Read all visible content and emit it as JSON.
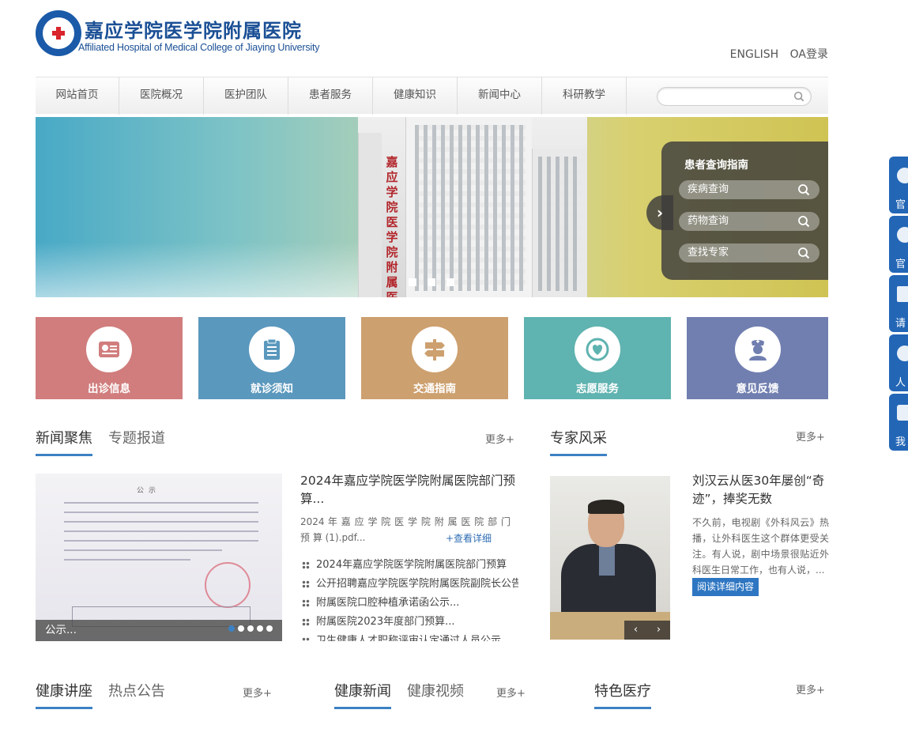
{
  "header": {
    "title_cn": "嘉应学院医学院附属医院",
    "title_en": "Affiliated Hospital of Medical College of Jiaying University",
    "links": [
      "ENGLISH",
      "OA登录"
    ]
  },
  "nav": {
    "items": [
      "网站首页",
      "医院概况",
      "医护团队",
      "患者服务",
      "健康知识",
      "新闻中心",
      "科研教学"
    ],
    "search_placeholder": ""
  },
  "banner": {
    "sign_text": "嘉应学院医学院附属医院",
    "guide": {
      "title": "患者查询指南",
      "buttons": [
        "疾病查询",
        "药物查询",
        "查找专家"
      ]
    },
    "slide_count": 3
  },
  "tiles": [
    {
      "label": "出诊信息",
      "color": "#d17d7d",
      "icon": "schedule-icon"
    },
    {
      "label": "就诊须知",
      "color": "#5b98bd",
      "icon": "clipboard-icon"
    },
    {
      "label": "交通指南",
      "color": "#cda06f",
      "icon": "signpost-icon"
    },
    {
      "label": "志愿服务",
      "color": "#5fb3b0",
      "icon": "volunteer-icon"
    },
    {
      "label": "意见反馈",
      "color": "#717fb0",
      "icon": "nurse-icon"
    }
  ],
  "news": {
    "tabs": [
      "新闻聚焦",
      "专题报道"
    ],
    "more": "更多+",
    "photo_doc_title": "公示",
    "photo_caption": "公示...",
    "headline": "2024年嘉应学院医学院附属医院部门预算...",
    "summary": "2024 年 嘉 应 学 院 医 学 院 附 属 医 院 部 门 预 算 (1).pdf...",
    "detail_link": "+查看详细",
    "list": [
      "2024年嘉应学院医学院附属医院部门预算",
      "公开招聘嘉应学院医学院附属医院副院长公告",
      "附属医院口腔种植承诺函公示...",
      "附属医院2023年度部门预算...",
      "卫生健康人才职称评审认定通过人员公示"
    ]
  },
  "expert": {
    "tab": "专家风采",
    "more": "更多+",
    "title": "刘汉云从医30年屡创“奇迹”，捧奖无数",
    "text": "不久前，电视剧《外科风云》热播，让外科医生这个群体更受关注。有人说，剧中场景很贴近外科医生日常工作，也有人说，...",
    "read_button": "阅读详细内容",
    "prev": "‹",
    "next": "›"
  },
  "bottom": {
    "group1": {
      "tabs": [
        "健康讲座",
        "热点公告"
      ],
      "more": "更多+"
    },
    "group2": {
      "tabs": [
        "健康新闻",
        "健康视频"
      ],
      "more": "更多+"
    },
    "group3": {
      "tabs": [
        "特色医疗"
      ],
      "more": "更多+"
    }
  },
  "float_bar": {
    "items": [
      {
        "label": "官",
        "icon": "weibo-icon"
      },
      {
        "label": "官",
        "icon": "wechat-icon"
      },
      {
        "label": "请",
        "icon": "mail-icon"
      },
      {
        "label": "人",
        "icon": "person-icon"
      },
      {
        "label": "我",
        "icon": "phone-icon"
      }
    ]
  }
}
